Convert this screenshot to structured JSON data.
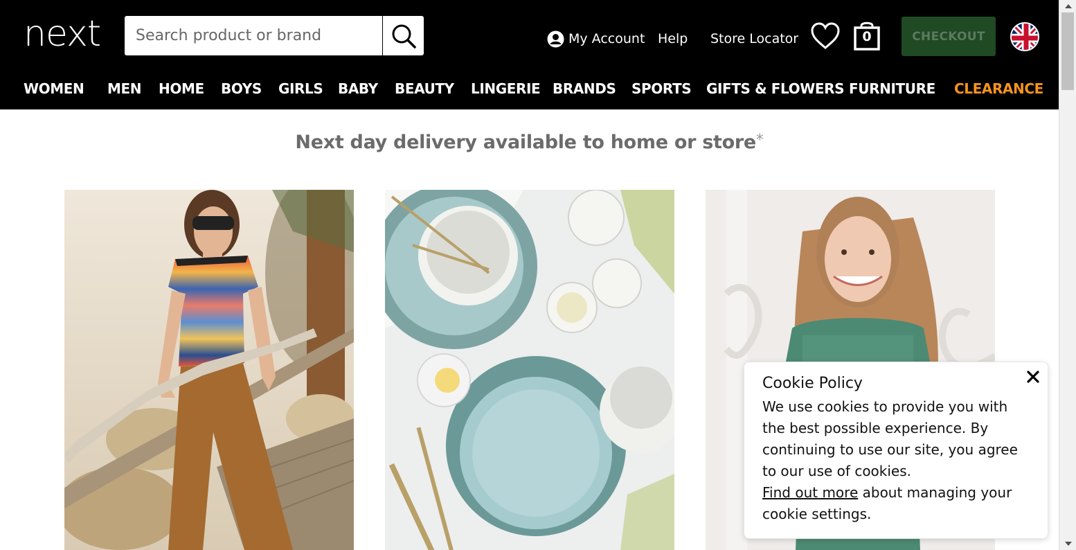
{
  "header": {
    "logo_text": "next",
    "search": {
      "placeholder": "Search product or brand",
      "value": ""
    },
    "links": {
      "account": "My Account",
      "help": "Help",
      "store_locator": "Store Locator"
    },
    "bag_count": "0",
    "checkout_label": "CHECKOUT",
    "nav": [
      {
        "label": "WOMEN"
      },
      {
        "label": "MEN"
      },
      {
        "label": "HOME"
      },
      {
        "label": "BOYS"
      },
      {
        "label": "GIRLS"
      },
      {
        "label": "BABY"
      },
      {
        "label": "BEAUTY"
      },
      {
        "label": "LINGERIE"
      },
      {
        "label": "BRANDS"
      },
      {
        "label": "SPORTS"
      },
      {
        "label": "GIFTS & FLOWERS"
      },
      {
        "label": "FURNITURE"
      },
      {
        "label": "CLEARANCE"
      }
    ]
  },
  "colors": {
    "header_bg": "#000000",
    "clearance": "#f7931e",
    "checkout_bg": "#1f4a24"
  },
  "main": {
    "delivery_text": "Next day delivery available to home or store",
    "delivery_star": "*"
  },
  "cookie": {
    "title": "Cookie Policy",
    "body": "We use cookies to provide you with the best possible experience. By continuing to use our site, you agree to our use of cookies.",
    "link_text": "Find out more",
    "link_suffix": " about managing your cookie settings."
  }
}
